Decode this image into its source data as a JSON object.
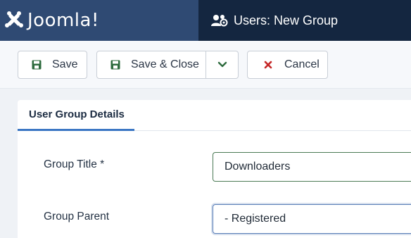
{
  "brand": {
    "name": "Joomla!"
  },
  "header": {
    "title": "Users: New Group"
  },
  "toolbar": {
    "save_label": "Save",
    "save_close_label": "Save & Close",
    "cancel_label": "Cancel"
  },
  "tabs": [
    {
      "label": "User Group Details",
      "active": true
    }
  ],
  "form": {
    "group_title_label": "Group Title *",
    "group_title_value": "Downloaders",
    "group_parent_label": "Group Parent",
    "group_parent_selected": "- Registered"
  },
  "colors": {
    "brand_bg": "#2f4a73",
    "title_bg": "#142640",
    "save_icon": "#2e6b3e",
    "cancel_icon": "#c52828",
    "tab_accent": "#3b76c4"
  }
}
